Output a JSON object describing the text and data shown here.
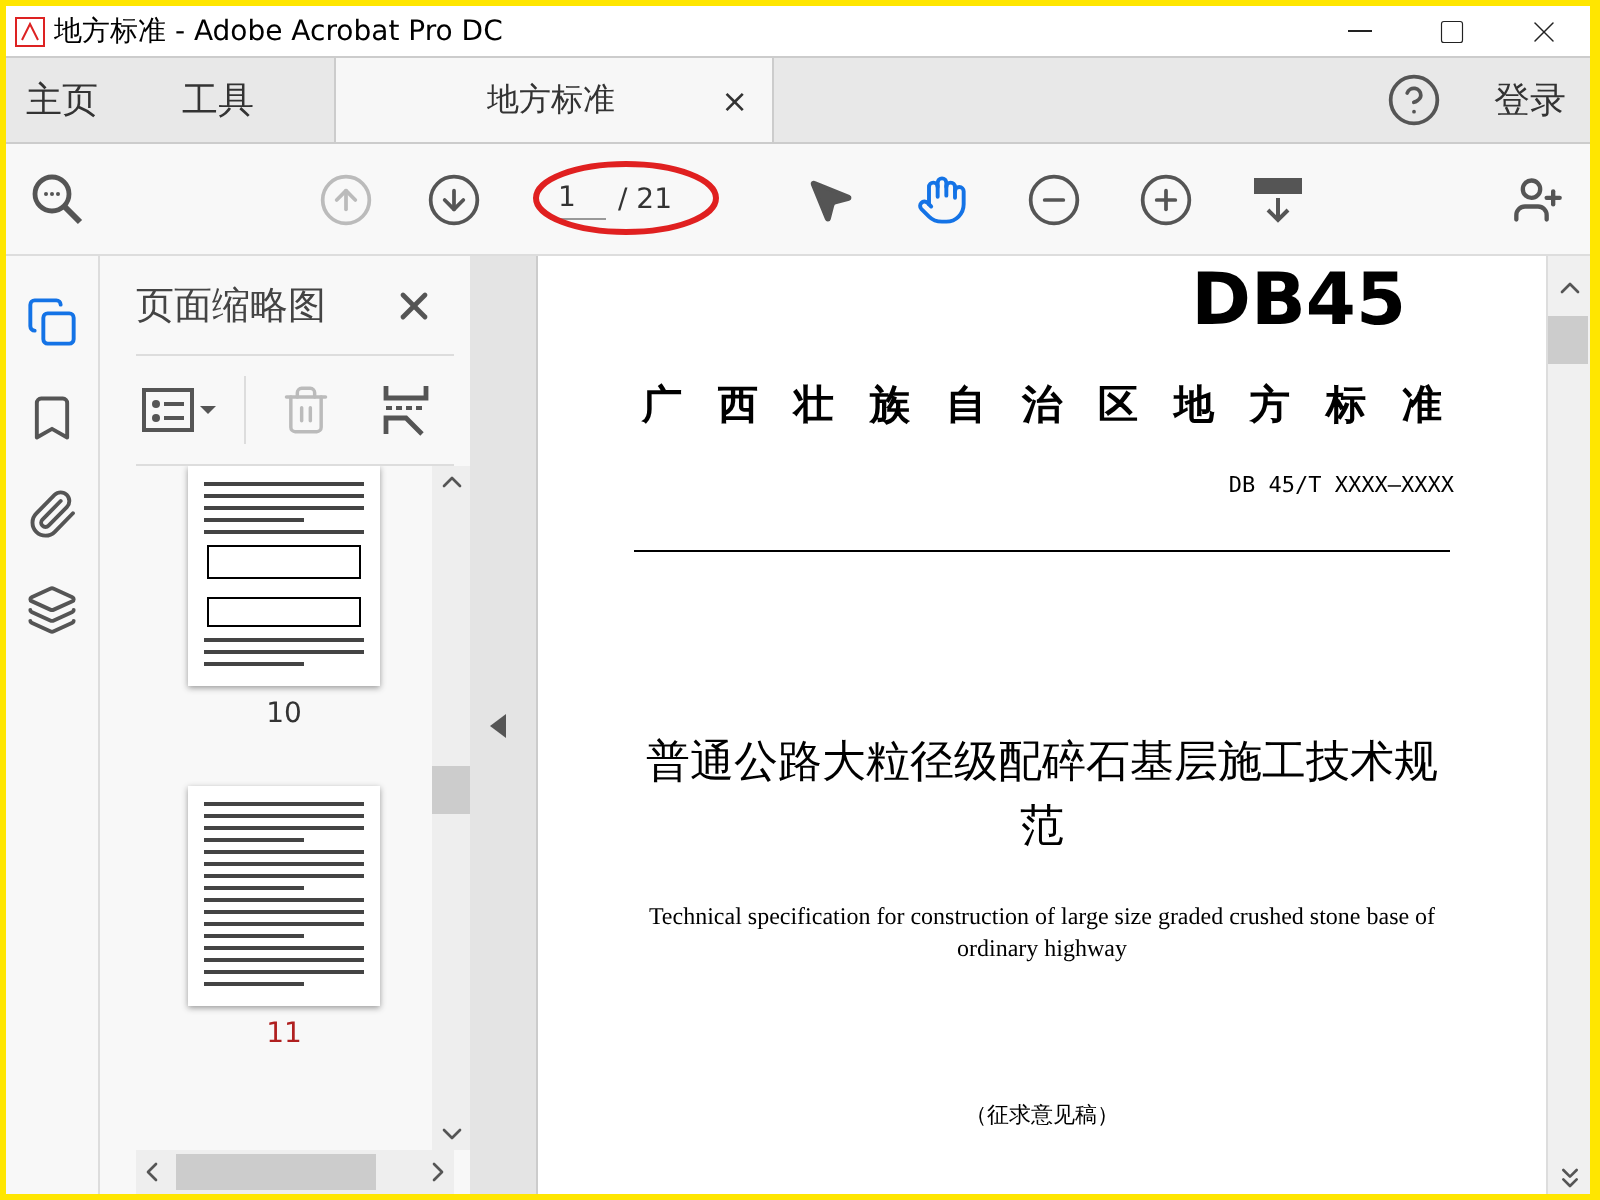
{
  "window": {
    "title": "地方标准 - Adobe Acrobat Pro DC"
  },
  "tabs": [
    {
      "label": "主页",
      "selected": false
    },
    {
      "label": "工具",
      "selected": false
    },
    {
      "label": "地方标准",
      "selected": true,
      "close": "×"
    }
  ],
  "signin": "登录",
  "nav": [
    {
      "kind": "prev",
      "disabled": true
    },
    {
      "kind": "next",
      "disabled": false
    }
  ],
  "page_box": {
    "current": "1",
    "total": "/ 21"
  },
  "tools": [
    {
      "kind": "select",
      "selected": false
    },
    {
      "kind": "hand",
      "selected": true
    }
  ],
  "side_rail": [
    {
      "kind": "pages",
      "selected": true
    },
    {
      "kind": "bookmarks",
      "selected": false
    },
    {
      "kind": "attachments",
      "selected": false
    },
    {
      "kind": "layers",
      "selected": false
    }
  ],
  "thumbnails_panel": {
    "title": "页面缩略图",
    "delete_disabled": true,
    "thumbnails": [
      {
        "label": "10",
        "kind": "tables"
      },
      {
        "label": "11",
        "kind": "text"
      }
    ]
  },
  "document": {
    "logo": "DB45",
    "region_title": "广西壮族自治区地方标准",
    "code": "DB 45/T XXXX—XXXX",
    "title": "普通公路大粒径级配碎石基层施工技术规范",
    "english": "Technical specification for construction of large size graded crushed stone base of ordinary highway",
    "note": "（征求意见稿）"
  }
}
